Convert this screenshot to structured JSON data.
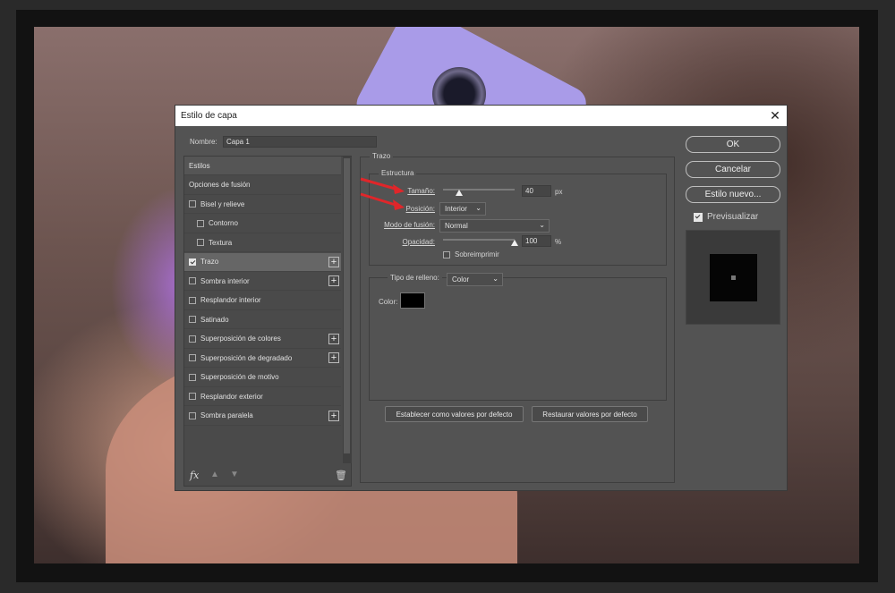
{
  "dialog": {
    "title": "Estilo de capa",
    "close_symbol": "✕",
    "name_label": "Nombre:",
    "name_value": "Capa 1"
  },
  "styles_list": {
    "header": "Estilos",
    "items": [
      {
        "label": "Opciones de fusión",
        "checkbox": false,
        "checked": false,
        "plus": false,
        "indent": false
      },
      {
        "label": "Bisel y relieve",
        "checkbox": true,
        "checked": false,
        "plus": false,
        "indent": false
      },
      {
        "label": "Contorno",
        "checkbox": true,
        "checked": false,
        "plus": false,
        "indent": true
      },
      {
        "label": "Textura",
        "checkbox": true,
        "checked": false,
        "plus": false,
        "indent": true
      },
      {
        "label": "Trazo",
        "checkbox": true,
        "checked": true,
        "plus": true,
        "indent": false,
        "selected": true
      },
      {
        "label": "Sombra interior",
        "checkbox": true,
        "checked": false,
        "plus": true,
        "indent": false
      },
      {
        "label": "Resplandor interior",
        "checkbox": true,
        "checked": false,
        "plus": false,
        "indent": false
      },
      {
        "label": "Satinado",
        "checkbox": true,
        "checked": false,
        "plus": false,
        "indent": false
      },
      {
        "label": "Superposición de colores",
        "checkbox": true,
        "checked": false,
        "plus": true,
        "indent": false
      },
      {
        "label": "Superposición de degradado",
        "checkbox": true,
        "checked": false,
        "plus": true,
        "indent": false
      },
      {
        "label": "Superposición de motivo",
        "checkbox": true,
        "checked": false,
        "plus": false,
        "indent": false
      },
      {
        "label": "Resplandor exterior",
        "checkbox": true,
        "checked": false,
        "plus": false,
        "indent": false
      },
      {
        "label": "Sombra paralela",
        "checkbox": true,
        "checked": false,
        "plus": true,
        "indent": false
      }
    ],
    "footer": {
      "fx": "fx",
      "up_icon": "arrow-up-icon",
      "down_icon": "arrow-down-icon",
      "trash_icon": "trash-icon"
    }
  },
  "stroke": {
    "group_title": "Trazo",
    "structure_title": "Estructura",
    "size_label": "Tamaño:",
    "size_value": "40",
    "size_unit": "px",
    "size_slider_fraction": 0.22,
    "position_label": "Posición:",
    "position_value": "Interior",
    "blend_label": "Modo de fusión:",
    "blend_value": "Normal",
    "opacity_label": "Opacidad:",
    "opacity_value": "100",
    "opacity_unit": "%",
    "opacity_slider_fraction": 1.0,
    "overprint_label": "Sobreimprimir",
    "overprint_checked": false,
    "fill_type_label": "Tipo de relleno:",
    "fill_type_value": "Color",
    "color_label": "Color:",
    "color_value": "#000000",
    "default_button": "Establecer como valores por defecto",
    "reset_button": "Restaurar valores por defecto"
  },
  "actions": {
    "ok": "OK",
    "cancel": "Cancelar",
    "new_style": "Estilo nuevo...",
    "preview_label": "Previsualizar",
    "preview_checked": true
  },
  "annotation_color": "#e0262a"
}
